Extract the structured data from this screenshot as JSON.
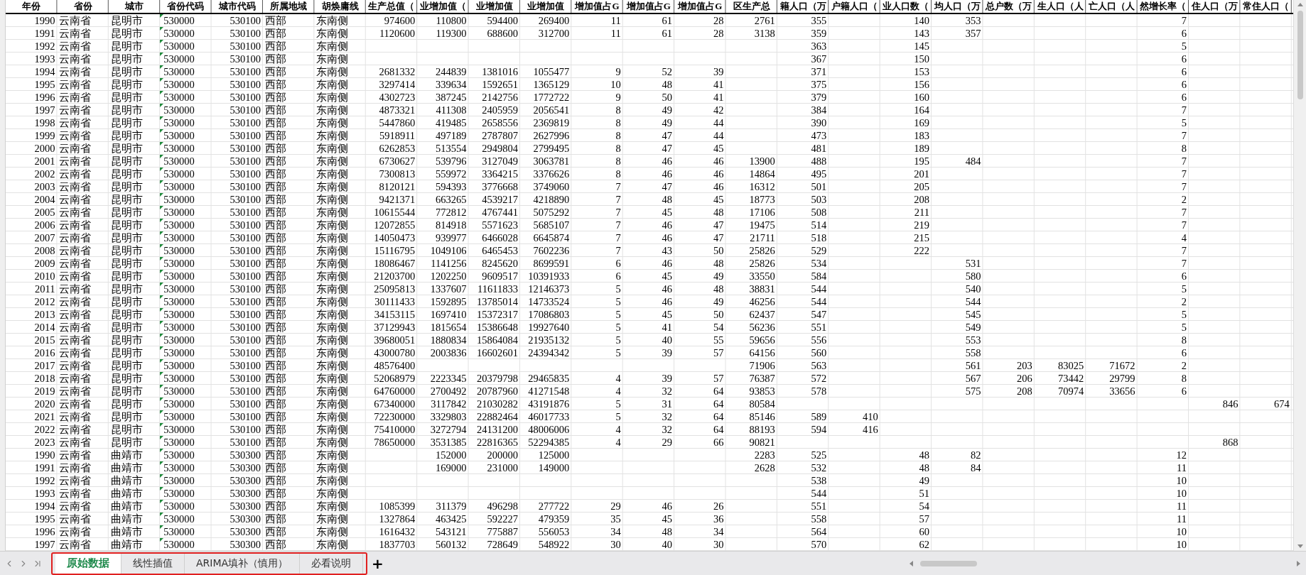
{
  "columns": [
    {
      "header": "年份",
      "kind": "number"
    },
    {
      "header": "省份",
      "kind": "text"
    },
    {
      "header": "城市",
      "kind": "text"
    },
    {
      "header": "省份代码",
      "kind": "number_as_text"
    },
    {
      "header": "城市代码",
      "kind": "number"
    },
    {
      "header": "所属地域",
      "kind": "text"
    },
    {
      "header": "胡焕庸线",
      "kind": "text"
    },
    {
      "header": "生产总值（",
      "kind": "number"
    },
    {
      "header": "业增加值（",
      "kind": "number"
    },
    {
      "header": "业增加值",
      "kind": "number"
    },
    {
      "header": "业增加值",
      "kind": "number"
    },
    {
      "header": "增加值占G",
      "kind": "number"
    },
    {
      "header": "增加值占G",
      "kind": "number"
    },
    {
      "header": "增加值占G",
      "kind": "number"
    },
    {
      "header": "区生产总",
      "kind": "number"
    },
    {
      "header": "籍人口（万",
      "kind": "number"
    },
    {
      "header": "户籍人口（",
      "kind": "number"
    },
    {
      "header": "业人口数（",
      "kind": "number"
    },
    {
      "header": "均人口（万",
      "kind": "number"
    },
    {
      "header": "总户数（万",
      "kind": "number"
    },
    {
      "header": "生人口（人",
      "kind": "number"
    },
    {
      "header": "亡人口（人",
      "kind": "number"
    },
    {
      "header": "然增长率（",
      "kind": "number"
    },
    {
      "header": "住人口（万",
      "kind": "number"
    },
    {
      "header": "常住人口（",
      "kind": "number"
    }
  ],
  "rows": [
    [
      "1990",
      "云南省",
      "昆明市",
      "530000",
      "530100",
      "西部",
      "东南侧",
      "974600",
      "110800",
      "594400",
      "269400",
      "11",
      "61",
      "28",
      "2761",
      "355",
      null,
      "140",
      "353",
      null,
      null,
      null,
      "7",
      null,
      null
    ],
    [
      "1991",
      "云南省",
      "昆明市",
      "530000",
      "530100",
      "西部",
      "东南侧",
      "1120600",
      "119300",
      "688600",
      "312700",
      "11",
      "61",
      "28",
      "3138",
      "359",
      null,
      "143",
      "357",
      null,
      null,
      null,
      "6",
      null,
      null
    ],
    [
      "1992",
      "云南省",
      "昆明市",
      "530000",
      "530100",
      "西部",
      "东南侧",
      null,
      null,
      null,
      null,
      null,
      null,
      null,
      null,
      "363",
      null,
      "145",
      null,
      null,
      null,
      null,
      "5",
      null,
      null
    ],
    [
      "1993",
      "云南省",
      "昆明市",
      "530000",
      "530100",
      "西部",
      "东南侧",
      null,
      null,
      null,
      null,
      null,
      null,
      null,
      null,
      "367",
      null,
      "150",
      null,
      null,
      null,
      null,
      "6",
      null,
      null
    ],
    [
      "1994",
      "云南省",
      "昆明市",
      "530000",
      "530100",
      "西部",
      "东南侧",
      "2681332",
      "244839",
      "1381016",
      "1055477",
      "9",
      "52",
      "39",
      null,
      "371",
      null,
      "153",
      null,
      null,
      null,
      null,
      "6",
      null,
      null
    ],
    [
      "1995",
      "云南省",
      "昆明市",
      "530000",
      "530100",
      "西部",
      "东南侧",
      "3297414",
      "339634",
      "1592651",
      "1365129",
      "10",
      "48",
      "41",
      null,
      "375",
      null,
      "156",
      null,
      null,
      null,
      null,
      "6",
      null,
      null
    ],
    [
      "1996",
      "云南省",
      "昆明市",
      "530000",
      "530100",
      "西部",
      "东南侧",
      "4302723",
      "387245",
      "2142756",
      "1772722",
      "9",
      "50",
      "41",
      null,
      "379",
      null,
      "160",
      null,
      null,
      null,
      null,
      "6",
      null,
      null
    ],
    [
      "1997",
      "云南省",
      "昆明市",
      "530000",
      "530100",
      "西部",
      "东南侧",
      "4873321",
      "411308",
      "2405959",
      "2056541",
      "8",
      "49",
      "42",
      null,
      "384",
      null,
      "164",
      null,
      null,
      null,
      null,
      "7",
      null,
      null
    ],
    [
      "1998",
      "云南省",
      "昆明市",
      "530000",
      "530100",
      "西部",
      "东南侧",
      "5447860",
      "419485",
      "2658556",
      "2369819",
      "8",
      "49",
      "44",
      null,
      "390",
      null,
      "169",
      null,
      null,
      null,
      null,
      "5",
      null,
      null
    ],
    [
      "1999",
      "云南省",
      "昆明市",
      "530000",
      "530100",
      "西部",
      "东南侧",
      "5918911",
      "497189",
      "2787807",
      "2627996",
      "8",
      "47",
      "44",
      null,
      "473",
      null,
      "183",
      null,
      null,
      null,
      null,
      "7",
      null,
      null
    ],
    [
      "2000",
      "云南省",
      "昆明市",
      "530000",
      "530100",
      "西部",
      "东南侧",
      "6262853",
      "513554",
      "2949804",
      "2799495",
      "8",
      "47",
      "45",
      null,
      "481",
      null,
      "189",
      null,
      null,
      null,
      null,
      "8",
      null,
      null
    ],
    [
      "2001",
      "云南省",
      "昆明市",
      "530000",
      "530100",
      "西部",
      "东南侧",
      "6730627",
      "539796",
      "3127049",
      "3063781",
      "8",
      "46",
      "46",
      "13900",
      "488",
      null,
      "195",
      "484",
      null,
      null,
      null,
      "7",
      null,
      null
    ],
    [
      "2002",
      "云南省",
      "昆明市",
      "530000",
      "530100",
      "西部",
      "东南侧",
      "7300813",
      "559972",
      "3364215",
      "3376626",
      "8",
      "46",
      "46",
      "14864",
      "495",
      null,
      "201",
      null,
      null,
      null,
      null,
      "7",
      null,
      null
    ],
    [
      "2003",
      "云南省",
      "昆明市",
      "530000",
      "530100",
      "西部",
      "东南侧",
      "8120121",
      "594393",
      "3776668",
      "3749060",
      "7",
      "47",
      "46",
      "16312",
      "501",
      null,
      "205",
      null,
      null,
      null,
      null,
      "7",
      null,
      null
    ],
    [
      "2004",
      "云南省",
      "昆明市",
      "530000",
      "530100",
      "西部",
      "东南侧",
      "9421371",
      "663265",
      "4539217",
      "4218890",
      "7",
      "48",
      "45",
      "18773",
      "503",
      null,
      "208",
      null,
      null,
      null,
      null,
      "2",
      null,
      null
    ],
    [
      "2005",
      "云南省",
      "昆明市",
      "530000",
      "530100",
      "西部",
      "东南侧",
      "10615544",
      "772812",
      "4767441",
      "5075292",
      "7",
      "45",
      "48",
      "17106",
      "508",
      null,
      "211",
      null,
      null,
      null,
      null,
      "7",
      null,
      null
    ],
    [
      "2006",
      "云南省",
      "昆明市",
      "530000",
      "530100",
      "西部",
      "东南侧",
      "12072855",
      "814918",
      "5571623",
      "5685107",
      "7",
      "46",
      "47",
      "19475",
      "514",
      null,
      "219",
      null,
      null,
      null,
      null,
      "7",
      null,
      null
    ],
    [
      "2007",
      "云南省",
      "昆明市",
      "530000",
      "530100",
      "西部",
      "东南侧",
      "14050473",
      "939977",
      "6466028",
      "6645874",
      "7",
      "46",
      "47",
      "21711",
      "518",
      null,
      "215",
      null,
      null,
      null,
      null,
      "4",
      null,
      null
    ],
    [
      "2008",
      "云南省",
      "昆明市",
      "530000",
      "530100",
      "西部",
      "东南侧",
      "15116795",
      "1049106",
      "6465453",
      "7602236",
      "7",
      "43",
      "50",
      "25826",
      "529",
      null,
      "222",
      null,
      null,
      null,
      null,
      "7",
      null,
      null
    ],
    [
      "2009",
      "云南省",
      "昆明市",
      "530000",
      "530100",
      "西部",
      "东南侧",
      "18086467",
      "1141256",
      "8245620",
      "8699591",
      "6",
      "46",
      "48",
      "25826",
      "534",
      null,
      null,
      "531",
      null,
      null,
      null,
      "7",
      null,
      null
    ],
    [
      "2010",
      "云南省",
      "昆明市",
      "530000",
      "530100",
      "西部",
      "东南侧",
      "21203700",
      "1202250",
      "9609517",
      "10391933",
      "6",
      "45",
      "49",
      "33550",
      "584",
      null,
      null,
      "580",
      null,
      null,
      null,
      "6",
      null,
      null
    ],
    [
      "2011",
      "云南省",
      "昆明市",
      "530000",
      "530100",
      "西部",
      "东南侧",
      "25095813",
      "1337607",
      "11611833",
      "12146373",
      "5",
      "46",
      "48",
      "38831",
      "544",
      null,
      null,
      "540",
      null,
      null,
      null,
      "5",
      null,
      null
    ],
    [
      "2012",
      "云南省",
      "昆明市",
      "530000",
      "530100",
      "西部",
      "东南侧",
      "30111433",
      "1592895",
      "13785014",
      "14733524",
      "5",
      "46",
      "49",
      "46256",
      "544",
      null,
      null,
      "544",
      null,
      null,
      null,
      "2",
      null,
      null
    ],
    [
      "2013",
      "云南省",
      "昆明市",
      "530000",
      "530100",
      "西部",
      "东南侧",
      "34153115",
      "1697410",
      "15372317",
      "17086803",
      "5",
      "45",
      "50",
      "62437",
      "547",
      null,
      null,
      "545",
      null,
      null,
      null,
      "5",
      null,
      null
    ],
    [
      "2014",
      "云南省",
      "昆明市",
      "530000",
      "530100",
      "西部",
      "东南侧",
      "37129943",
      "1815654",
      "15386648",
      "19927640",
      "5",
      "41",
      "54",
      "56236",
      "551",
      null,
      null,
      "549",
      null,
      null,
      null,
      "5",
      null,
      null
    ],
    [
      "2015",
      "云南省",
      "昆明市",
      "530000",
      "530100",
      "西部",
      "东南侧",
      "39680051",
      "1880834",
      "15864084",
      "21935132",
      "5",
      "40",
      "55",
      "59656",
      "556",
      null,
      null,
      "553",
      null,
      null,
      null,
      "8",
      null,
      null
    ],
    [
      "2016",
      "云南省",
      "昆明市",
      "530000",
      "530100",
      "西部",
      "东南侧",
      "43000780",
      "2003836",
      "16602601",
      "24394342",
      "5",
      "39",
      "57",
      "64156",
      "560",
      null,
      null,
      "558",
      null,
      null,
      null,
      "6",
      null,
      null
    ],
    [
      "2017",
      "云南省",
      "昆明市",
      "530000",
      "530100",
      "西部",
      "东南侧",
      "48576400",
      null,
      null,
      null,
      null,
      null,
      null,
      "71906",
      "563",
      null,
      null,
      "561",
      "203",
      "83025",
      "71672",
      "2",
      null,
      null
    ],
    [
      "2018",
      "云南省",
      "昆明市",
      "530000",
      "530100",
      "西部",
      "东南侧",
      "52068979",
      "2223345",
      "20379798",
      "29465835",
      "4",
      "39",
      "57",
      "76387",
      "572",
      null,
      null,
      "567",
      "206",
      "73442",
      "29799",
      "8",
      null,
      null
    ],
    [
      "2019",
      "云南省",
      "昆明市",
      "530000",
      "530100",
      "西部",
      "东南侧",
      "64760000",
      "2700492",
      "20787960",
      "41271548",
      "4",
      "32",
      "64",
      "93853",
      "578",
      null,
      null,
      "575",
      "208",
      "70974",
      "33656",
      "6",
      null,
      null
    ],
    [
      "2020",
      "云南省",
      "昆明市",
      "530000",
      "530100",
      "西部",
      "东南侧",
      "67340000",
      "3117842",
      "21030282",
      "43191876",
      "5",
      "31",
      "64",
      "80584",
      null,
      null,
      null,
      null,
      null,
      null,
      null,
      null,
      "846",
      "674"
    ],
    [
      "2021",
      "云南省",
      "昆明市",
      "530000",
      "530100",
      "西部",
      "东南侧",
      "72230000",
      "3329803",
      "22882464",
      "46017733",
      "5",
      "32",
      "64",
      "85146",
      "589",
      "410",
      null,
      null,
      null,
      null,
      null,
      null,
      null,
      null
    ],
    [
      "2022",
      "云南省",
      "昆明市",
      "530000",
      "530100",
      "西部",
      "东南侧",
      "75410000",
      "3272794",
      "24131200",
      "48006006",
      "4",
      "32",
      "64",
      "88193",
      "594",
      "416",
      null,
      null,
      null,
      null,
      null,
      null,
      null,
      null
    ],
    [
      "2023",
      "云南省",
      "昆明市",
      "530000",
      "530100",
      "西部",
      "东南侧",
      "78650000",
      "3531385",
      "22816365",
      "52294385",
      "4",
      "29",
      "66",
      "90821",
      null,
      null,
      null,
      null,
      null,
      null,
      null,
      null,
      "868",
      null
    ],
    [
      "1990",
      "云南省",
      "曲靖市",
      "530000",
      "530300",
      "西部",
      "东南侧",
      null,
      "152000",
      "200000",
      "125000",
      null,
      null,
      null,
      "2283",
      "525",
      null,
      "48",
      "82",
      null,
      null,
      null,
      "12",
      null,
      null
    ],
    [
      "1991",
      "云南省",
      "曲靖市",
      "530000",
      "530300",
      "西部",
      "东南侧",
      null,
      "169000",
      "231000",
      "149000",
      null,
      null,
      null,
      "2628",
      "532",
      null,
      "48",
      "84",
      null,
      null,
      null,
      "11",
      null,
      null
    ],
    [
      "1992",
      "云南省",
      "曲靖市",
      "530000",
      "530300",
      "西部",
      "东南侧",
      null,
      null,
      null,
      null,
      null,
      null,
      null,
      null,
      "538",
      null,
      "49",
      null,
      null,
      null,
      null,
      "10",
      null,
      null
    ],
    [
      "1993",
      "云南省",
      "曲靖市",
      "530000",
      "530300",
      "西部",
      "东南侧",
      null,
      null,
      null,
      null,
      null,
      null,
      null,
      null,
      "544",
      null,
      "51",
      null,
      null,
      null,
      null,
      "10",
      null,
      null
    ],
    [
      "1994",
      "云南省",
      "曲靖市",
      "530000",
      "530300",
      "西部",
      "东南侧",
      "1085399",
      "311379",
      "496298",
      "277722",
      "29",
      "46",
      "26",
      null,
      "551",
      null,
      "54",
      null,
      null,
      null,
      null,
      "11",
      null,
      null
    ],
    [
      "1995",
      "云南省",
      "曲靖市",
      "530000",
      "530300",
      "西部",
      "东南侧",
      "1327864",
      "463425",
      "592227",
      "479359",
      "35",
      "45",
      "36",
      null,
      "558",
      null,
      "57",
      null,
      null,
      null,
      null,
      "11",
      null,
      null
    ],
    [
      "1996",
      "云南省",
      "曲靖市",
      "530000",
      "530300",
      "西部",
      "东南侧",
      "1616432",
      "543121",
      "775887",
      "556053",
      "34",
      "48",
      "34",
      null,
      "564",
      null,
      "60",
      null,
      null,
      null,
      null,
      "10",
      null,
      null
    ],
    [
      "1997",
      "云南省",
      "曲靖市",
      "530000",
      "530300",
      "西部",
      "东南侧",
      "1837703",
      "560132",
      "728649",
      "548922",
      "30",
      "40",
      "30",
      null,
      "570",
      null,
      "62",
      null,
      null,
      null,
      null,
      "10",
      null,
      null
    ]
  ],
  "sheet_tabs": [
    {
      "label": "原始数据",
      "selected": true
    },
    {
      "label": "线性插值",
      "selected": false
    },
    {
      "label": "ARIMA填补（慎用）",
      "selected": false
    },
    {
      "label": "必看说明",
      "selected": false
    }
  ],
  "add_sheet": "+"
}
